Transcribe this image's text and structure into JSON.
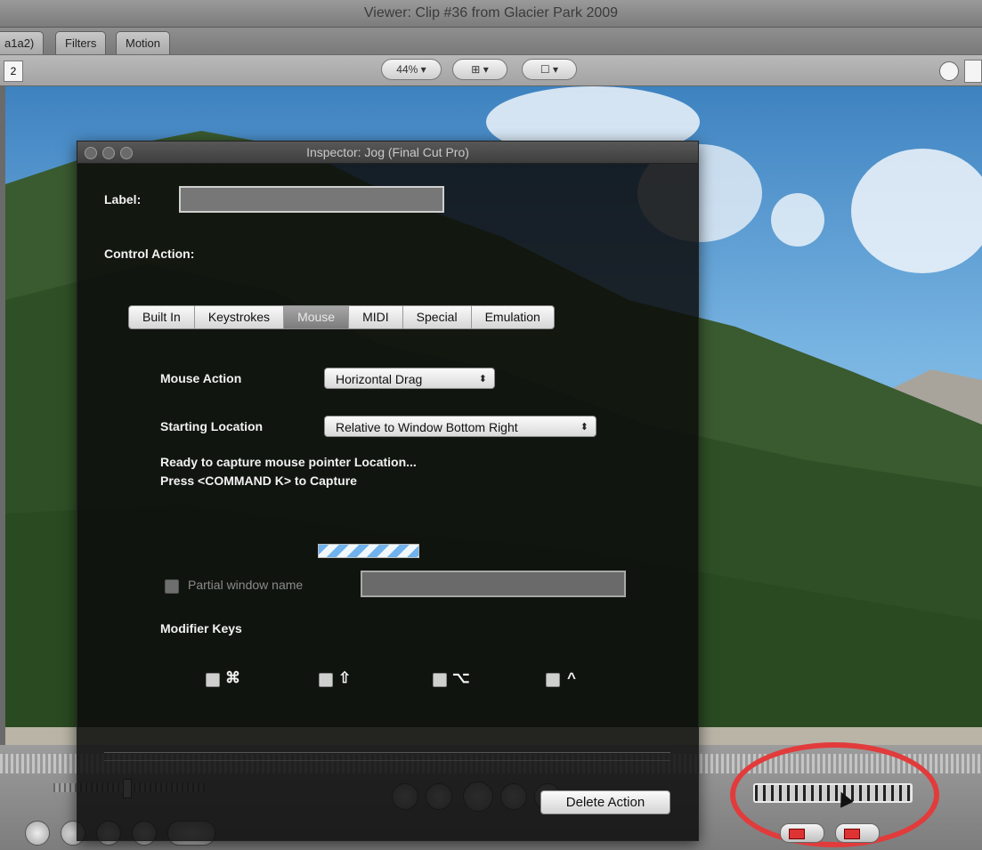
{
  "viewer": {
    "title": "Viewer: Clip #36 from Glacier Park 2009",
    "tabs": [
      "a1a2)",
      "Filters",
      "Motion"
    ],
    "left_field_value": "2",
    "zoom_label": "44%",
    "view_menu_label": "⊞",
    "overlay_menu_label": "☐"
  },
  "inspector": {
    "title": "Inspector: Jog (Final Cut Pro)",
    "label_caption": "Label:",
    "label_value": "",
    "control_action_caption": "Control Action:",
    "tabs": [
      "Built In",
      "Keystrokes",
      "Mouse",
      "MIDI",
      "Special",
      "Emulation"
    ],
    "active_tab": "Mouse",
    "mouse_action_caption": "Mouse Action",
    "mouse_action_value": "Horizontal Drag",
    "starting_location_caption": "Starting Location",
    "starting_location_value": "Relative to Window Bottom Right",
    "capture_line1": "Ready to capture mouse pointer Location...",
    "capture_line2": "Press <COMMAND K> to Capture",
    "partial_window_caption": "Partial window name",
    "partial_window_value": "",
    "modifier_keys_caption": "Modifier Keys",
    "modifier_symbols": [
      "⌘",
      "⇧",
      "⌥",
      "^"
    ],
    "delete_button_label": "Delete Action"
  },
  "colors": {
    "highlight_ring": "#e23b3b",
    "progress_stripe": "#6fb2ee"
  }
}
